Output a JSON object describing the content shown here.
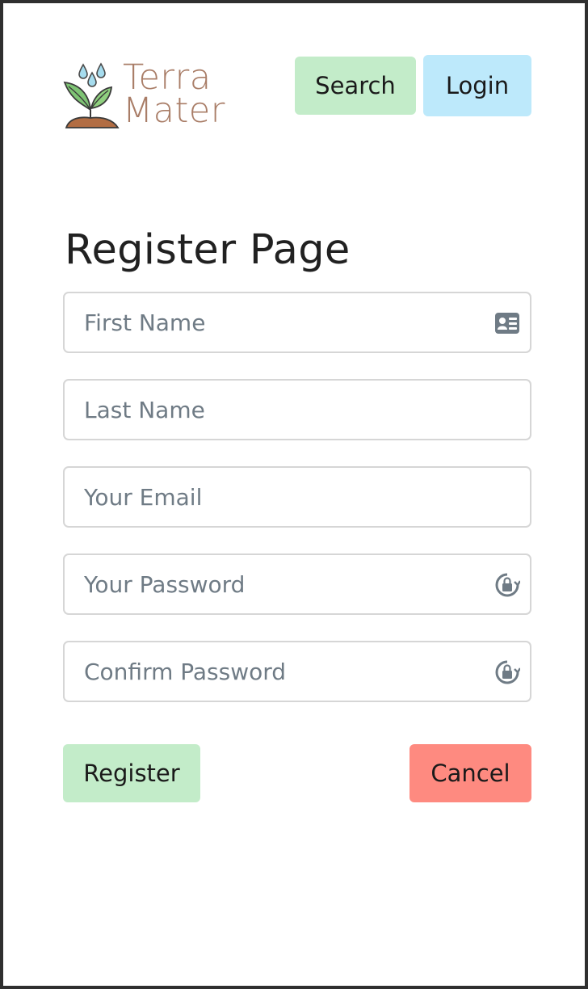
{
  "brand": {
    "line1": "Terra",
    "line2": "Mater"
  },
  "header": {
    "search_label": "Search",
    "login_label": "Login"
  },
  "page": {
    "title": "Register Page"
  },
  "form": {
    "first_name": {
      "placeholder": "First Name",
      "value": "",
      "icon": "contact-card-icon"
    },
    "last_name": {
      "placeholder": "Last Name",
      "value": ""
    },
    "email": {
      "placeholder": "Your Email",
      "value": ""
    },
    "password": {
      "placeholder": "Your Password",
      "value": "",
      "icon": "password-lock-icon"
    },
    "confirm_password": {
      "placeholder": "Confirm Password",
      "value": "",
      "icon": "password-lock-icon"
    },
    "register_label": "Register",
    "cancel_label": "Cancel"
  },
  "colors": {
    "brand_text": "#a97d67",
    "search_button": "#c3ecc9",
    "login_button": "#bde9fb",
    "register_button": "#c3ecc9",
    "cancel_button": "#fe8a80",
    "input_border": "#d6d6d6",
    "placeholder": "#6f7b85"
  }
}
